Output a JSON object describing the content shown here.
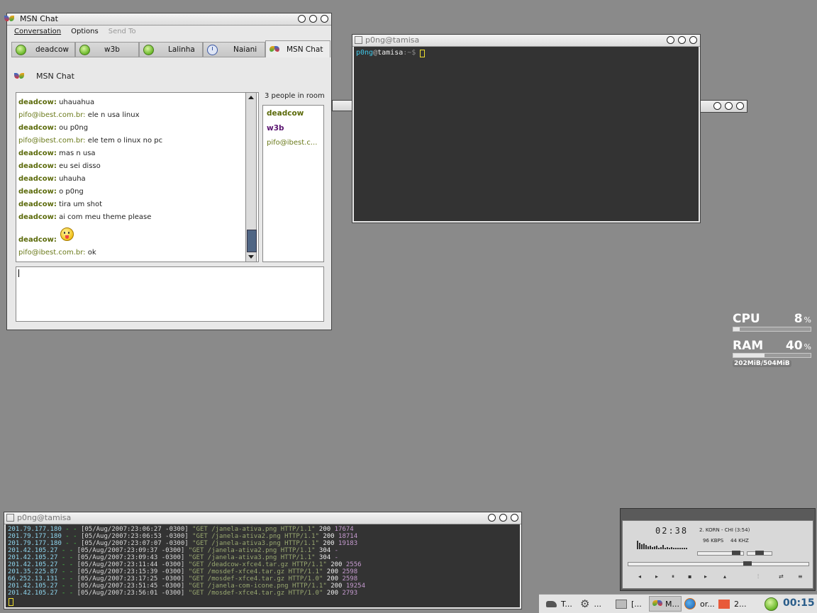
{
  "chat_window": {
    "title": "MSN Chat",
    "menu": [
      "Conversation",
      "Options",
      "Send To"
    ],
    "tabs": [
      "deadcow",
      "w3b",
      "Lalinha",
      "Naiani",
      "MSN Chat"
    ],
    "header_label": "MSN Chat",
    "people_count": "3 people in room",
    "people": [
      "deadcow",
      "w3b",
      "pifo@ibest.c..."
    ],
    "messages": [
      {
        "nick": "deadcow:",
        "text": "uhauahua"
      },
      {
        "nick": "pifo@ibest.com.br:",
        "text": "ele n usa linux"
      },
      {
        "nick": "deadcow:",
        "text": "ou p0ng"
      },
      {
        "nick": "pifo@ibest.com.br:",
        "text": "ele tem o linux no pc"
      },
      {
        "nick": "deadcow:",
        "text": "mas n usa"
      },
      {
        "nick": "deadcow:",
        "text": "eu sei disso"
      },
      {
        "nick": "deadcow:",
        "text": "uhauha"
      },
      {
        "nick": "deadcow:",
        "text": "o p0ng"
      },
      {
        "nick": "deadcow:",
        "text": "tira um shot"
      },
      {
        "nick": "deadcow:",
        "text": "ai com meu theme please"
      },
      {
        "nick": "deadcow:",
        "text": ""
      },
      {
        "nick": "pifo@ibest.com.br:",
        "text": "ok"
      }
    ]
  },
  "terminal_top": {
    "title": "p0ng@tamisa",
    "prompt_user": "p0ng",
    "prompt_at": "@",
    "prompt_host": "tamisa",
    "prompt_path": ":~$"
  },
  "terminal_bottom": {
    "title": "p0ng@tamisa",
    "lines": [
      {
        "ip": "201.79.177.180",
        "date": "[05/Aug/2007:23:06:27 -0300]",
        "req": "\"GET /janela-ativa.png HTTP/1.1\"",
        "code": "200",
        "size": "17674"
      },
      {
        "ip": "201.79.177.180",
        "date": "[05/Aug/2007:23:06:53 -0300]",
        "req": "\"GET /janela-ativa2.png HTTP/1.1\"",
        "code": "200",
        "size": "18714"
      },
      {
        "ip": "201.79.177.180",
        "date": "[05/Aug/2007:23:07:07 -0300]",
        "req": "\"GET /janela-ativa3.png HTTP/1.1\"",
        "code": "200",
        "size": "19183"
      },
      {
        "ip": "201.42.105.27",
        "date": "[05/Aug/2007:23:09:37 -0300]",
        "req": "\"GET /janela-ativa2.png HTTP/1.1\"",
        "code": "304",
        "size": "-"
      },
      {
        "ip": "201.42.105.27",
        "date": "[05/Aug/2007:23:09:43 -0300]",
        "req": "\"GET /janela-ativa3.png HTTP/1.1\"",
        "code": "304",
        "size": "-"
      },
      {
        "ip": "201.42.105.27",
        "date": "[05/Aug/2007:23:11:44 -0300]",
        "req": "\"GET /deadcow-xfce4.tar.gz HTTP/1.1\"",
        "code": "200",
        "size": "2556"
      },
      {
        "ip": "201.35.225.87",
        "date": "[05/Aug/2007:23:15:39 -0300]",
        "req": "\"GET /mosdef-xfce4.tar.gz HTTP/1.1\"",
        "code": "200",
        "size": "2598"
      },
      {
        "ip": "66.252.13.131",
        "date": "[05/Aug/2007:23:17:25 -0300]",
        "req": "\"GET /mosdef-xfce4.tar.gz HTTP/1.0\"",
        "code": "200",
        "size": "2598"
      },
      {
        "ip": "201.42.105.27",
        "date": "[05/Aug/2007:23:51:45 -0300]",
        "req": "\"GET /janela-com-icone.png HTTP/1.1\"",
        "code": "200",
        "size": "19254"
      },
      {
        "ip": "201.42.105.27",
        "date": "[05/Aug/2007:23:56:01 -0300]",
        "req": "\"GET /mosdef-xfce4.tar.gz HTTP/1.0\"",
        "code": "200",
        "size": "2793"
      }
    ]
  },
  "monitor": {
    "cpu_label": "CPU",
    "cpu_value": "8",
    "cpu_unit": "%",
    "cpu_fraction": 0.08,
    "ram_label": "RAM",
    "ram_value": "40",
    "ram_unit": "%",
    "ram_fraction": 0.4,
    "ram_detail": "202MiB/504MiB"
  },
  "player": {
    "time": "02:38",
    "track": "2. KORN - CHI (3:54)",
    "kbps": "96 KBPS",
    "khz": "44 KHZ",
    "position_fraction": 0.66
  },
  "taskbar": {
    "items": [
      "T...",
      "...",
      "[...",
      "M...",
      "or...",
      "2..."
    ],
    "clock": "00:15"
  }
}
